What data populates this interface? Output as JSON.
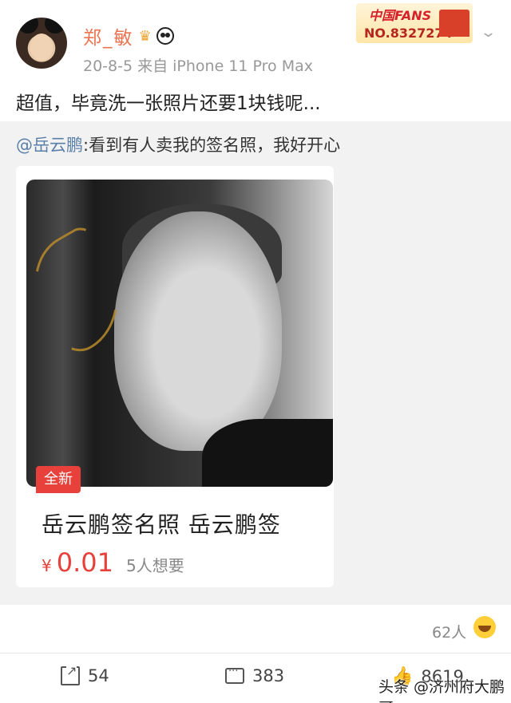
{
  "post": {
    "username": "郑_敏",
    "meta": "20-8-5   来自 iPhone 11 Pro Max",
    "fans_badge_logo": "中国FANS",
    "fans_badge_no": "NO.8327274",
    "text": "超值，毕竟洗一张照片还要1块钱呢..."
  },
  "repost": {
    "mention": "@岳云鹏",
    "text": ":看到有人卖我的签名照，我好开心",
    "card": {
      "badge": "全新",
      "title": "岳云鹏签名照 岳云鹏签",
      "price_symbol": "¥",
      "price": "0.01",
      "wants": "5人想要"
    }
  },
  "stats": {
    "likes_people": "62人"
  },
  "actions": {
    "share_count": "54",
    "comment_count": "383",
    "like_count": "8619"
  },
  "watermark": "头条 @济州府大鹏哥",
  "colors": {
    "username": "#eb7350",
    "mention": "#5a7fa8",
    "price": "#e8403a",
    "repost_bg": "#f2f2f2"
  },
  "icons": [
    "crown-icon",
    "panda-icon",
    "chevron-down-icon",
    "smile-icon",
    "share-icon",
    "comment-icon",
    "thumb-icon"
  ]
}
